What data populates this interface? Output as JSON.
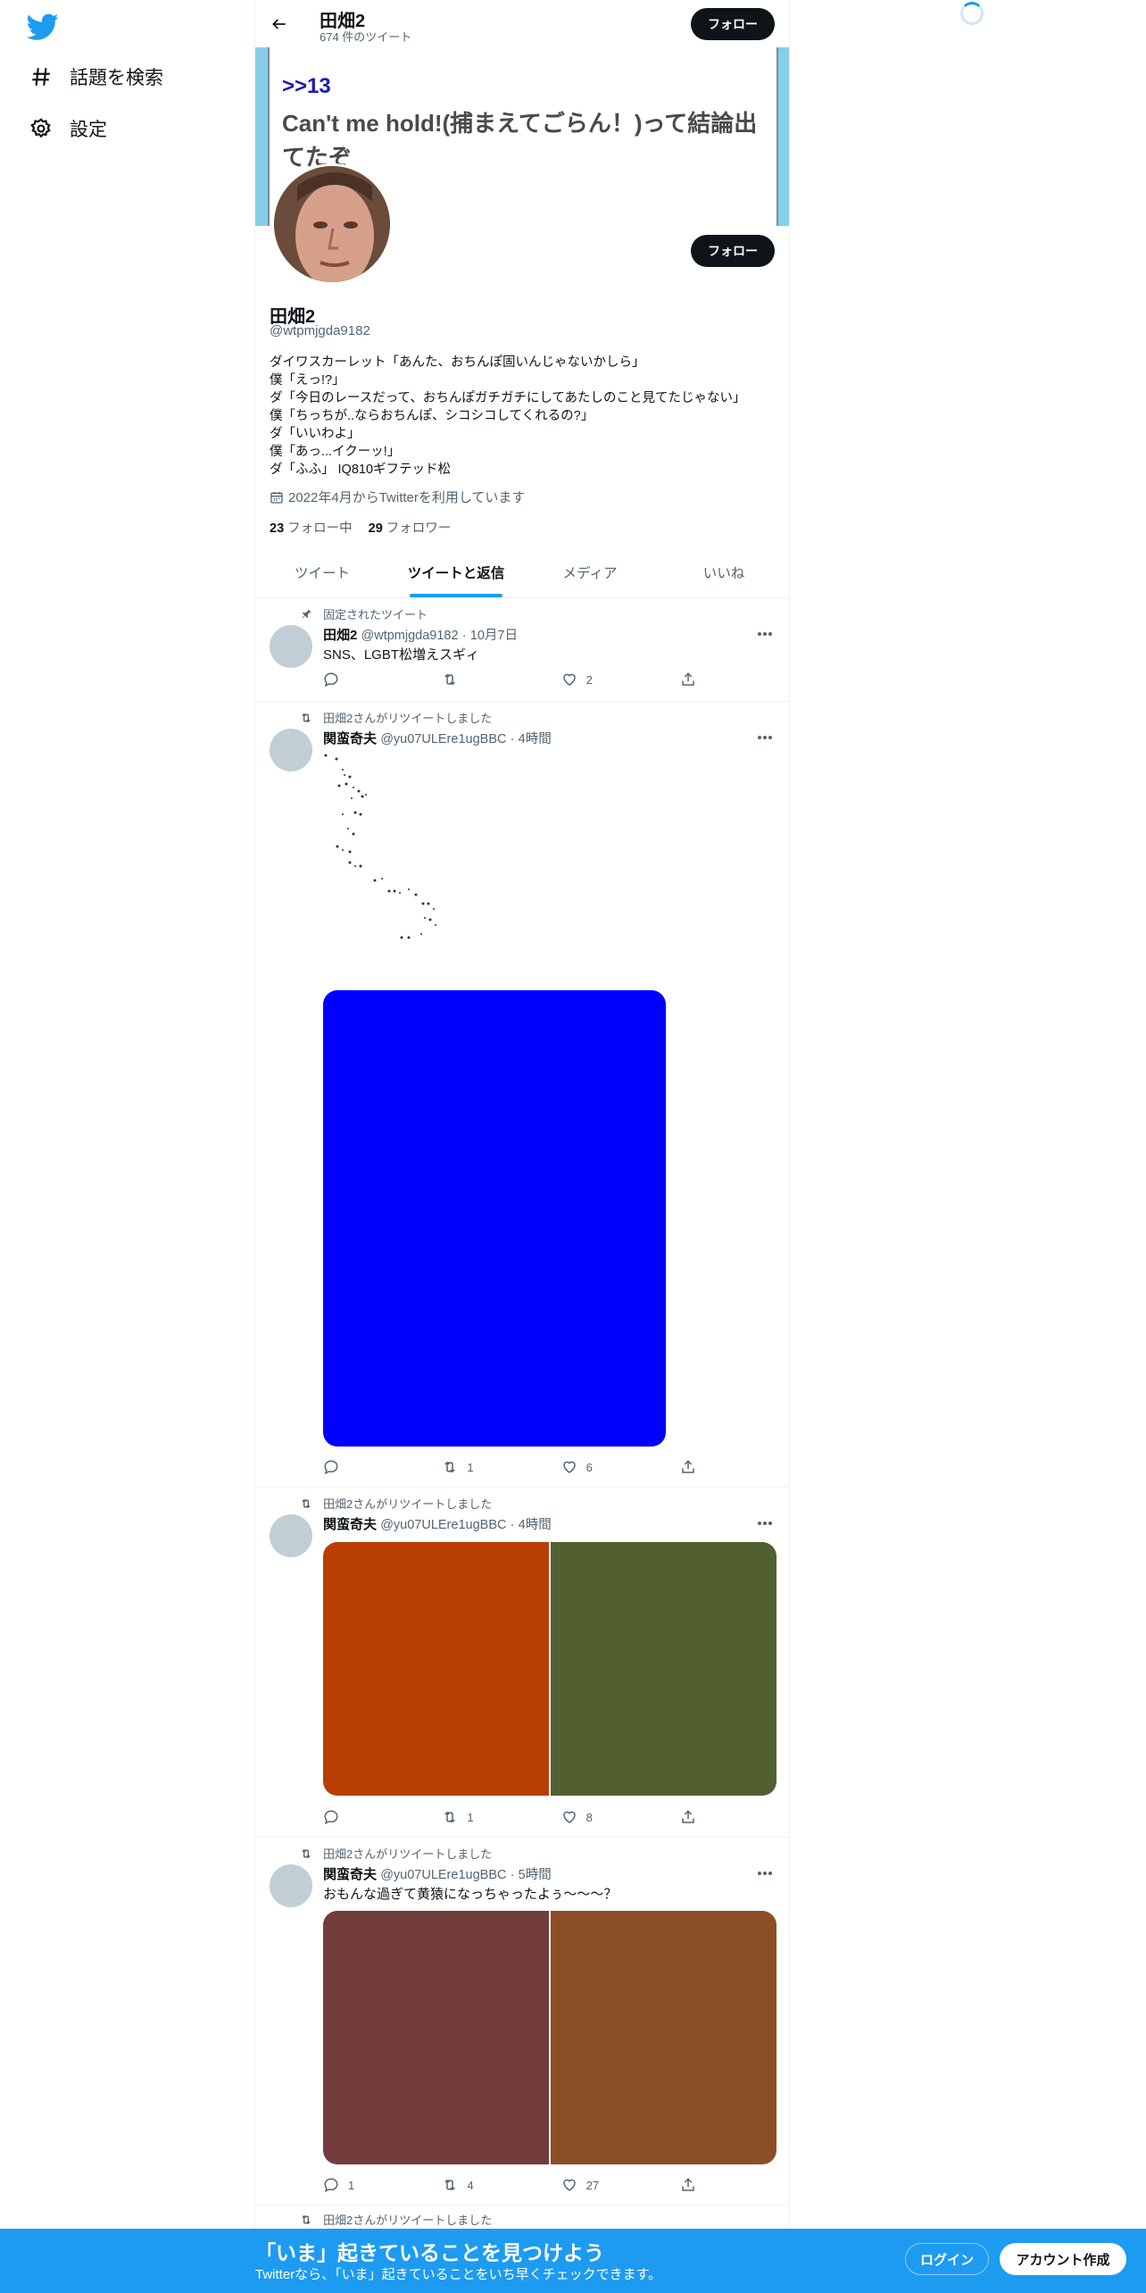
{
  "sidebar": {
    "items": [
      {
        "label": "話題を検索",
        "icon": "hashtag-icon"
      },
      {
        "label": "設定",
        "icon": "gear-icon"
      }
    ]
  },
  "header": {
    "title": "田畑2",
    "tweet_count": "674 件のツイート",
    "follow_label": "フォロー"
  },
  "banner": {
    "ref": ">>13",
    "text": "Can't me hold!(捕まえてごらん！)って結論出てたぞ"
  },
  "profile": {
    "name": "田畑2",
    "handle": "@wtpmjgda9182",
    "bio": [
      "ダイワスカーレット「あんた、おちんぽ固いんじゃないかしら」",
      "僕「えっ!?」",
      "ダ「今日のレースだって、おちんぽガチガチにしてあたしのこと見てたじゃない」",
      "僕「ちっちが..ならおちんぽ、シコシコしてくれるの?」",
      "ダ「いいわよ」",
      "僕「あっ...イクーッ!」",
      "ダ「ふふ」 IQ810ギフテッド松"
    ],
    "joined": "2022年4月からTwitterを利用しています",
    "following_count": "23",
    "following_label": "フォロー中",
    "followers_count": "29",
    "followers_label": "フォロワー"
  },
  "tabs": [
    {
      "label": "ツイート",
      "active": false
    },
    {
      "label": "ツイートと返信",
      "active": true
    },
    {
      "label": "メディア",
      "active": false
    },
    {
      "label": "いいね",
      "active": false
    }
  ],
  "tweets": [
    {
      "context": "固定されたツイート",
      "name": "田畑2",
      "handle": "@wtpmjgda9182",
      "time": "10月7日",
      "text": "SNS、LGBT松増えスギィ",
      "replies": "",
      "retweets": "",
      "likes": "2"
    },
    {
      "context": "田畑2さんがリツイートしました",
      "name": "関蛮奇夫",
      "handle": "@yu07ULEre1ugBBC",
      "time": "4時間",
      "text": "",
      "replies": "",
      "retweets": "1",
      "likes": "6",
      "media_colors": [
        "#0000ff"
      ]
    },
    {
      "context": "田畑2さんがリツイートしました",
      "name": "関蛮奇夫",
      "handle": "@yu07ULEre1ugBBC",
      "time": "4時間",
      "text": "",
      "replies": "",
      "retweets": "1",
      "likes": "8",
      "media_colors": [
        "#b93e06",
        "#52602f"
      ]
    },
    {
      "context": "田畑2さんがリツイートしました",
      "name": "関蛮奇夫",
      "handle": "@yu07ULEre1ugBBC",
      "time": "5時間",
      "text": "おもんな過ぎて黄猿になっちゃったよぅ〜〜〜？",
      "replies": "1",
      "retweets": "4",
      "likes": "27",
      "media_colors": [
        "#733c3c",
        "#8b4f27"
      ]
    },
    {
      "context": "田畑2さんがリツイートしました"
    }
  ],
  "bottom_bar": {
    "title": "「いま」起きていることを見つけよう",
    "subtitle": "Twitterなら、「いま」起きていることをいち早くチェックできます。",
    "login_label": "ログイン",
    "signup_label": "アカウント作成"
  }
}
